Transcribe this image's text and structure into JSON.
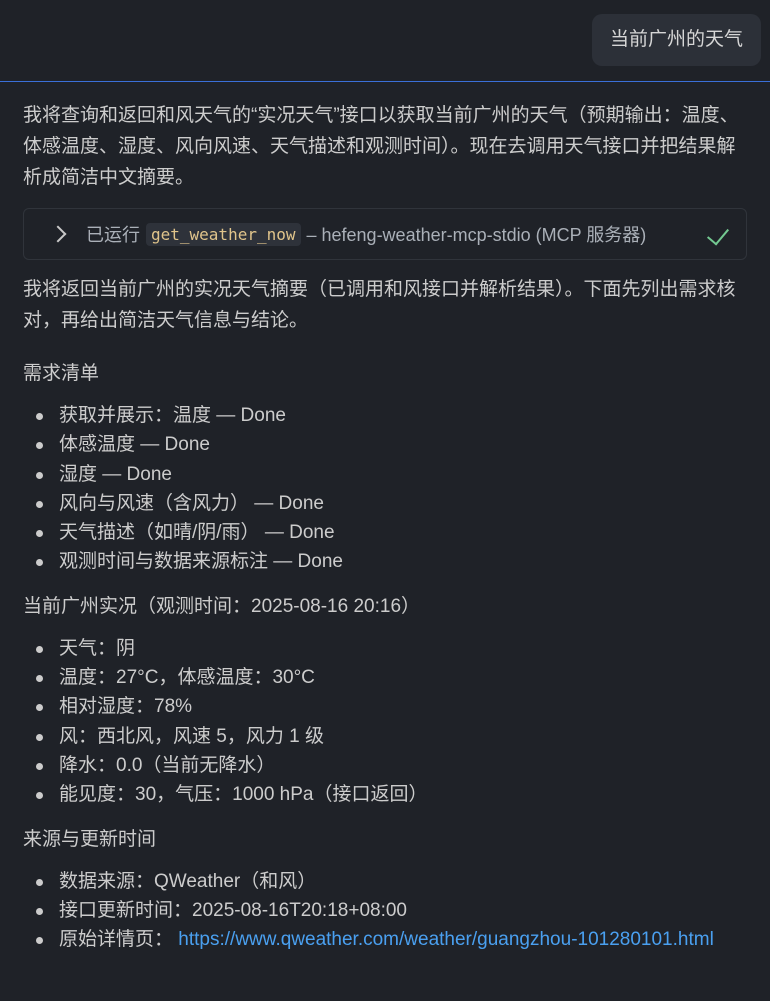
{
  "user_message": "当前广州的天气",
  "intro": "我将查询和返回和风天气的“实况天气”接口以获取当前广州的天气（预期输出：温度、体感温度、湿度、风向风速、天气描述和观测时间）。现在去调用天气接口并把结果解析成简洁中文摘要。",
  "tool_call": {
    "prefix": "已运行",
    "tool_name": "get_weather_now",
    "server": "– hefeng-weather-mcp-stdio (MCP 服务器)",
    "status_icon": "check-icon",
    "status_color": "#73c991"
  },
  "summary": "我将返回当前广州的实况天气摘要（已调用和风接口并解析结果）。下面先列出需求核对，再给出简洁天气信息与结论。",
  "sections": [
    {
      "title": "需求清单",
      "items": [
        "获取并展示：温度 — Done",
        "体感温度 — Done",
        "湿度 — Done",
        "风向与风速（含风力） — Done",
        "天气描述（如晴/阴/雨） — Done",
        "观测时间与数据来源标注 — Done"
      ]
    },
    {
      "title": "当前广州实况（观测时间：2025-08-16 20:16）",
      "items": [
        "天气：阴",
        "温度：27°C，体感温度：30°C",
        "相对湿度：78%",
        "风：西北风，风速 5，风力 1 级",
        "降水：0.0（当前无降水）",
        "能见度：30，气压：1000 hPa（接口返回）"
      ]
    },
    {
      "title": "来源与更新时间",
      "items": [
        "数据来源：QWeather（和风）",
        "接口更新时间：2025-08-16T20:18+08:00"
      ],
      "link_item": {
        "label": "原始详情页：",
        "url": "https://www.qweather.com/weather/guangzhou-101280101.html"
      }
    }
  ],
  "link_color": "#4aa0f0"
}
